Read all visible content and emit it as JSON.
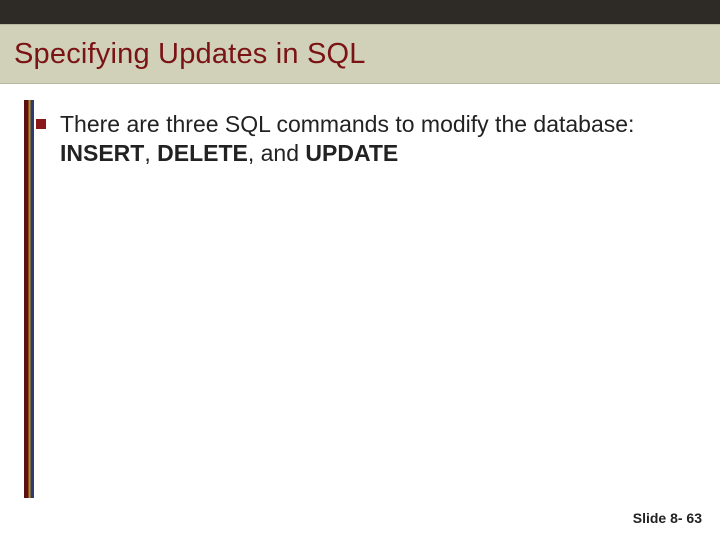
{
  "title": "Specifying Updates in SQL",
  "bullets": [
    {
      "pre": "There are three SQL commands to modify the database: ",
      "b1": "INSERT",
      "mid1": ", ",
      "b2": "DELETE",
      "mid2": ", and ",
      "b3": "UPDATE"
    }
  ],
  "footer": "Slide 8- 63"
}
